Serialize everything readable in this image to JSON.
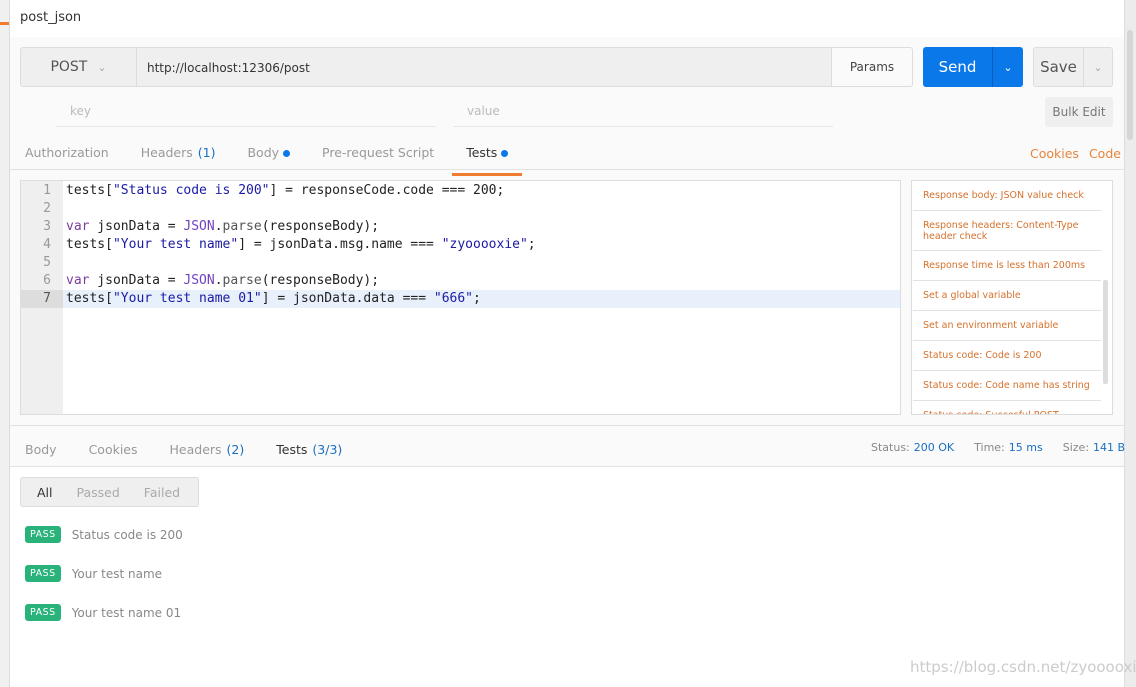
{
  "title": "post_json",
  "request": {
    "method": "POST",
    "url": "http://localhost:12306/post",
    "params_label": "Params",
    "send_label": "Send",
    "save_label": "Save",
    "key_placeholder": "key",
    "value_placeholder": "value",
    "bulk_edit_label": "Bulk Edit"
  },
  "req_tabs": [
    {
      "label": "Authorization"
    },
    {
      "label": "Headers",
      "count": "(1)"
    },
    {
      "label": "Body",
      "dot": true
    },
    {
      "label": "Pre-request Script"
    },
    {
      "label": "Tests",
      "dot": true,
      "active": true
    }
  ],
  "right_links": {
    "cookies": "Cookies",
    "code": "Code"
  },
  "editor": {
    "lines": [
      [
        [
          "tests[",
          ""
        ],
        [
          "\"Status code is 200\"",
          "str"
        ],
        [
          "] = responseCode.code === 200;",
          ""
        ]
      ],
      [],
      [
        [
          "var",
          "kw"
        ],
        [
          " jsonData = ",
          ""
        ],
        [
          "JSON",
          "obj"
        ],
        [
          ".",
          ""
        ],
        [
          "parse",
          "fn"
        ],
        [
          "(responseBody);",
          ""
        ]
      ],
      [
        [
          "tests[",
          ""
        ],
        [
          "\"Your test name\"",
          "str"
        ],
        [
          "] = jsonData.msg.name === ",
          ""
        ],
        [
          "\"zyooooxie\"",
          "str"
        ],
        [
          ";",
          ""
        ]
      ],
      [],
      [
        [
          "var",
          "kw"
        ],
        [
          " jsonData = ",
          ""
        ],
        [
          "JSON",
          "obj"
        ],
        [
          ".",
          ""
        ],
        [
          "parse",
          "fn"
        ],
        [
          "(responseBody);",
          ""
        ]
      ],
      [
        [
          "tests[",
          ""
        ],
        [
          "\"Your test name 01\"",
          "str"
        ],
        [
          "] = jsonData.data === ",
          ""
        ],
        [
          "\"666\"",
          "str"
        ],
        [
          ";",
          ""
        ]
      ]
    ],
    "current_line": 7
  },
  "snippets": [
    "Response body: JSON value check",
    "Response headers: Content-Type header check",
    "Response time is less than 200ms",
    "Set a global variable",
    "Set an environment variable",
    "Status code: Code is 200",
    "Status code: Code name has string",
    "Status code: Succesful POST"
  ],
  "resp_tabs": [
    {
      "label": "Body"
    },
    {
      "label": "Cookies"
    },
    {
      "label": "Headers",
      "count": "(2)"
    },
    {
      "label": "Tests",
      "count": "(3/3)",
      "active": true
    }
  ],
  "meta": {
    "status_label": "Status:",
    "status": "200 OK",
    "time_label": "Time:",
    "time": "15 ms",
    "size_label": "Size:",
    "size": "141 B"
  },
  "filters": [
    "All",
    "Passed",
    "Failed"
  ],
  "results": [
    {
      "badge": "PASS",
      "name": "Status code is 200"
    },
    {
      "badge": "PASS",
      "name": "Your test name"
    },
    {
      "badge": "PASS",
      "name": "Your test name 01"
    }
  ],
  "watermark": "https://blog.csdn.net/zyooooxie",
  "colors": {
    "accent": "#f07c30",
    "send": "#0a78e8",
    "pass": "#2ab27b",
    "snippet": "#d5712c"
  }
}
